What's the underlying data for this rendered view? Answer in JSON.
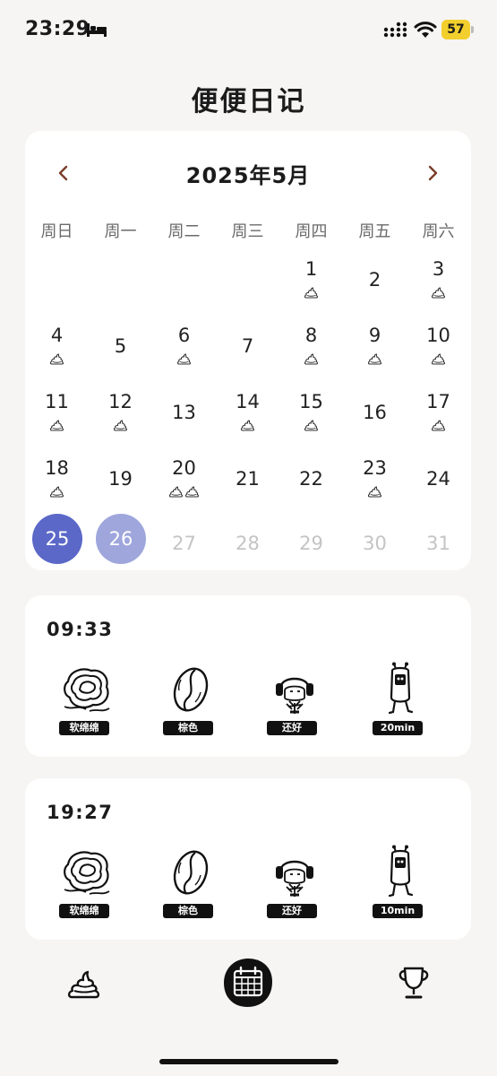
{
  "status_bar": {
    "time": "23:29",
    "battery": "57"
  },
  "title": "便便日记",
  "calendar": {
    "month_label": "2025年5月",
    "weekdays": [
      "周日",
      "周一",
      "周二",
      "周三",
      "周四",
      "周五",
      "周六"
    ],
    "days": [
      {
        "day": "1",
        "poops": 1
      },
      {
        "day": "2",
        "poops": 0
      },
      {
        "day": "3",
        "poops": 1
      },
      {
        "day": "4",
        "poops": 1
      },
      {
        "day": "5",
        "poops": 0
      },
      {
        "day": "6",
        "poops": 1
      },
      {
        "day": "7",
        "poops": 0
      },
      {
        "day": "8",
        "poops": 1
      },
      {
        "day": "9",
        "poops": 1
      },
      {
        "day": "10",
        "poops": 1
      },
      {
        "day": "11",
        "poops": 1
      },
      {
        "day": "12",
        "poops": 1
      },
      {
        "day": "13",
        "poops": 0
      },
      {
        "day": "14",
        "poops": 1
      },
      {
        "day": "15",
        "poops": 1
      },
      {
        "day": "16",
        "poops": 0
      },
      {
        "day": "17",
        "poops": 1
      },
      {
        "day": "18",
        "poops": 1
      },
      {
        "day": "19",
        "poops": 0
      },
      {
        "day": "20",
        "poops": 2
      },
      {
        "day": "21",
        "poops": 0
      },
      {
        "day": "22",
        "poops": 0
      },
      {
        "day": "23",
        "poops": 1
      },
      {
        "day": "24",
        "poops": 0
      },
      {
        "day": "25",
        "poops": 0,
        "state": "selected"
      },
      {
        "day": "26",
        "poops": 0,
        "state": "today"
      },
      {
        "day": "27",
        "poops": 0,
        "state": "future"
      },
      {
        "day": "28",
        "poops": 0,
        "state": "future"
      },
      {
        "day": "29",
        "poops": 0,
        "state": "future"
      },
      {
        "day": "30",
        "poops": 0,
        "state": "future"
      },
      {
        "day": "31",
        "poops": 0,
        "state": "future"
      }
    ],
    "selected_color": "#5b68c8",
    "today_color": "#9ea6dc"
  },
  "entries": [
    {
      "time": "09:33",
      "texture": "软绵绵",
      "color": "棕色",
      "feeling": "还好",
      "duration": "20min"
    },
    {
      "time": "19:27",
      "texture": "软绵绵",
      "color": "棕色",
      "feeling": "还好",
      "duration": "10min"
    }
  ],
  "nav": {
    "items": [
      "poop-icon",
      "calendar-icon",
      "trophy-icon"
    ],
    "active": "calendar-icon"
  }
}
